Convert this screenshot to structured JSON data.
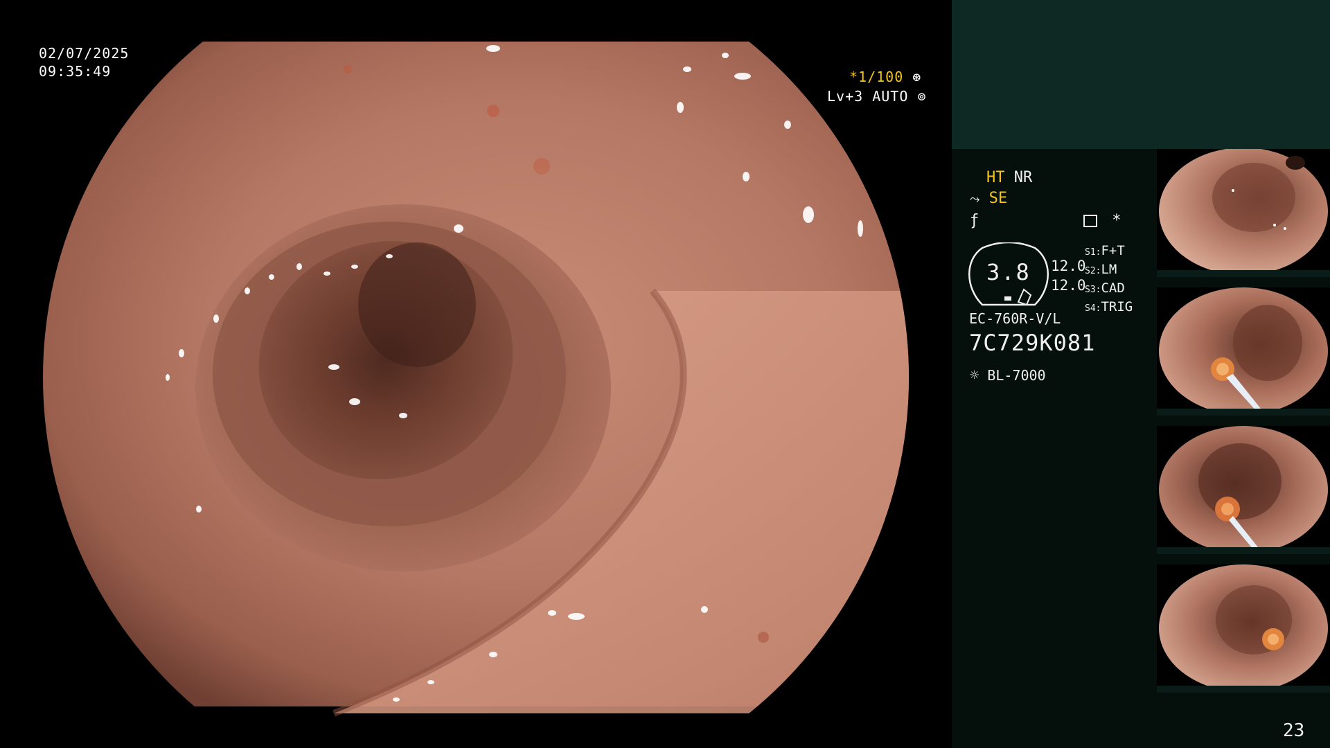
{
  "osd": {
    "date": "02/07/2025",
    "time": "09:35:49",
    "shutter": "*1/100",
    "level": "Lv+3",
    "mode": "AUTO"
  },
  "panel": {
    "ht_label": "HT",
    "nr_label": "NR",
    "se_label": "SE",
    "star": "*",
    "gauge_value": "3.8",
    "value_a": "12.0",
    "value_b": "12.0",
    "switches": [
      {
        "key": "S1:",
        "value": "F+T"
      },
      {
        "key": "S2:",
        "value": "LM"
      },
      {
        "key": "S3:",
        "value": "CAD"
      },
      {
        "key": "S4:",
        "value": "TRIG"
      }
    ],
    "scope_model": "EC-760R-V/L",
    "serial": "7C729K081",
    "light_source": "BL-7000",
    "page_number": "23"
  },
  "colors": {
    "tissue": "#b57864",
    "panel_top": "#0e2923",
    "panel_bg": "#050f0c",
    "accent_yellow": "#f5c518"
  }
}
